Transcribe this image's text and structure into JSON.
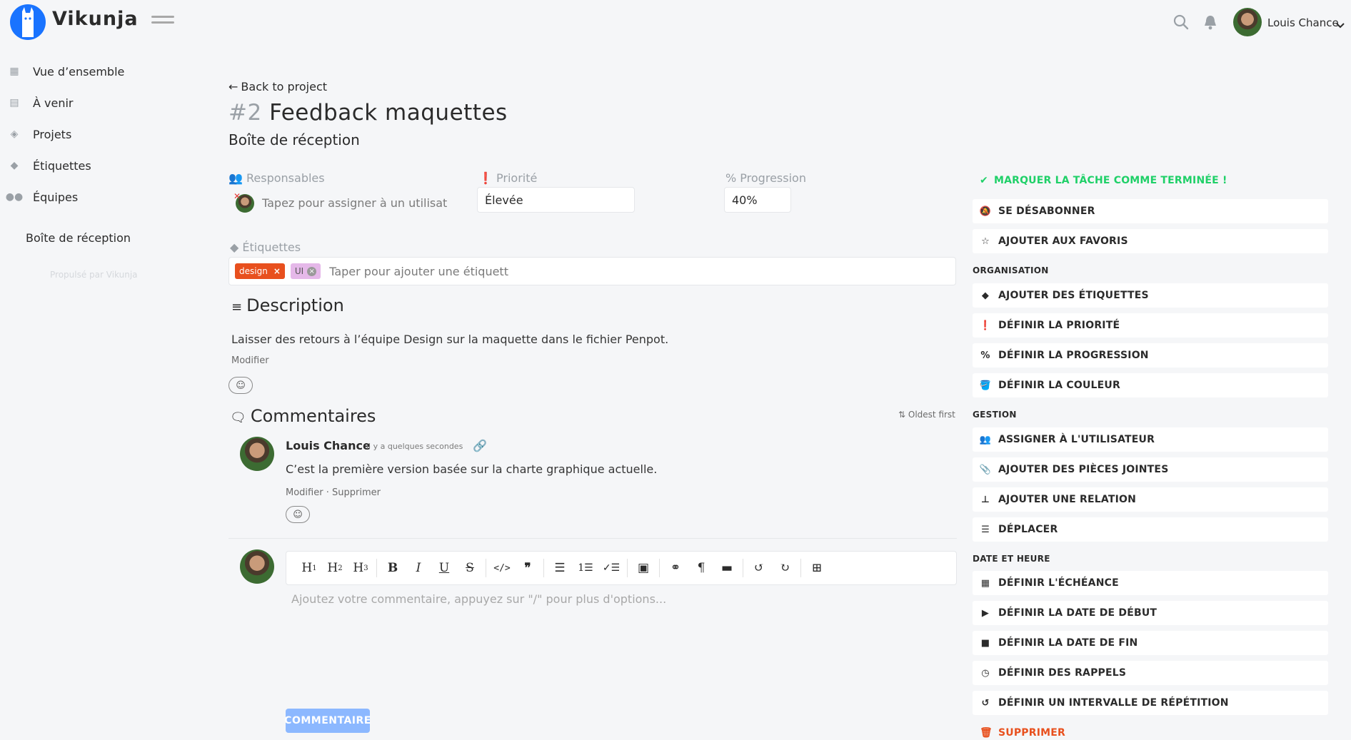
{
  "header": {
    "app_name": "Vikunja",
    "user_name": "Louis Chance"
  },
  "sidebar": {
    "items": [
      {
        "label": "Vue d’ensemble",
        "icon": "calendar-icon"
      },
      {
        "label": "À venir",
        "icon": "calendar-grid-icon"
      },
      {
        "label": "Projets",
        "icon": "layers-icon"
      },
      {
        "label": "Étiquettes",
        "icon": "tags-icon"
      },
      {
        "label": "Équipes",
        "icon": "users-icon"
      }
    ],
    "project": "Boîte de réception",
    "powered_by": "Propulsé par Vikunja"
  },
  "task": {
    "back_label": "Back to project",
    "number": "#2",
    "title": "Feedback maquettes",
    "project": "Boîte de réception",
    "assignees_label": "Responsables",
    "assignees_placeholder": "Tapez pour assigner à un utilisat",
    "priority_label": "Priorité",
    "priority_value": "Élevée",
    "progress_label": "Progression",
    "progress_value": "40%",
    "labels_label": "Étiquettes",
    "labels": [
      {
        "text": "design",
        "color": "#e8501e"
      },
      {
        "text": "UI",
        "color": "#e5b8e9"
      }
    ],
    "labels_placeholder": "Taper pour ajouter une étiquett",
    "description_title": "Description",
    "description_text": "Laisser des retours à l’équipe Design sur la maquette dans le fichier Penpot.",
    "description_edit": "Modifier"
  },
  "comments": {
    "title": "Commentaires",
    "sort_label": "Oldest first",
    "items": [
      {
        "author": "Louis Chance",
        "time": "il y a quelques secondes",
        "text": "C’est la première version basée sur la charte graphique actuelle.",
        "edit": "Modifier",
        "separator": "·",
        "delete": "Supprimer"
      }
    ],
    "editor_placeholder": "Ajoutez votre commentaire, appuyez sur \"/\" pour plus d'options...",
    "submit_label": "COMMENTAIRE"
  },
  "actions": {
    "done": "MARQUER LA TÂCHE COMME TERMINÉE !",
    "unsubscribe": "SE DÉSABONNER",
    "favorite": "AJOUTER AUX FAVORIS",
    "organisation_head": "ORGANISATION",
    "add_labels": "AJOUTER DES ÉTIQUETTES",
    "set_priority": "DÉFINIR LA PRIORITÉ",
    "set_progress": "DÉFINIR LA PROGRESSION",
    "set_color": "DÉFINIR LA COULEUR",
    "management_head": "GESTION",
    "assign_user": "ASSIGNER À L'UTILISATEUR",
    "add_attachments": "AJOUTER DES PIÈCES JOINTES",
    "add_relation": "AJOUTER UNE RELATION",
    "move": "DÉPLACER",
    "datetime_head": "DATE ET HEURE",
    "set_due": "DÉFINIR L'ÉCHÉANCE",
    "set_start": "DÉFINIR LA DATE DE DÉBUT",
    "set_end": "DÉFINIR LA DATE DE FIN",
    "set_reminders": "DÉFINIR DES RAPPELS",
    "set_repeat": "DÉFINIR UN INTERVALLE DE RÉPÉTITION",
    "delete": "SUPPRIMER"
  },
  "colors": {
    "primary": "#1973ff",
    "success": "#1fd068",
    "danger": "#e8501e",
    "button_disabled": "#8cb8ff"
  }
}
